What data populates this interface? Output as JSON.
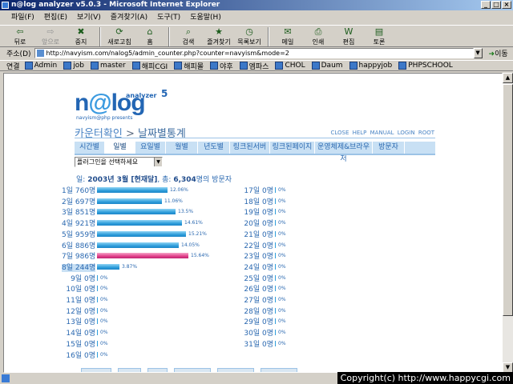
{
  "window": {
    "title": "n@log analyzer v5.0.3 - Microsoft Internet Explorer",
    "min_label": "_",
    "max_label": "□",
    "close_label": "×"
  },
  "menu": [
    "파일(F)",
    "편집(E)",
    "보기(V)",
    "즐겨찾기(A)",
    "도구(T)",
    "도움말(H)"
  ],
  "toolbar": [
    {
      "label": "뒤로",
      "icon": "back-arrow-icon",
      "glyph": "⇦",
      "disabled": false
    },
    {
      "label": "앞으로",
      "icon": "forward-arrow-icon",
      "glyph": "⇨",
      "disabled": true
    },
    {
      "label": "중지",
      "icon": "stop-icon",
      "glyph": "✖",
      "disabled": false
    },
    {
      "label": "새로고침",
      "icon": "refresh-icon",
      "glyph": "⟳",
      "disabled": false
    },
    {
      "label": "홈",
      "icon": "home-icon",
      "glyph": "⌂",
      "disabled": false
    },
    {
      "label": "검색",
      "icon": "search-icon",
      "glyph": "⌕",
      "disabled": false
    },
    {
      "label": "즐겨찾기",
      "icon": "favorites-icon",
      "glyph": "★",
      "disabled": false
    },
    {
      "label": "목록보기",
      "icon": "history-icon",
      "glyph": "◷",
      "disabled": false
    },
    {
      "label": "메일",
      "icon": "mail-icon",
      "glyph": "✉",
      "disabled": false
    },
    {
      "label": "인쇄",
      "icon": "print-icon",
      "glyph": "⎙",
      "disabled": false
    },
    {
      "label": "편집",
      "icon": "edit-icon",
      "glyph": "W",
      "disabled": false
    },
    {
      "label": "토론",
      "icon": "discuss-icon",
      "glyph": "▤",
      "disabled": false
    }
  ],
  "address": {
    "label": "주소(D)",
    "url": "http://navyism.com/nalog5/admin_counter.php?counter=navyism&mode=2",
    "go_label": "이동"
  },
  "links": {
    "label": "연결",
    "items": [
      "Admin",
      "job",
      "master",
      "해피CGI",
      "해피몰",
      "야후",
      "엠파스",
      "CHOL",
      "Daum",
      "happyjob",
      "PHPSCHOOL"
    ]
  },
  "page": {
    "logo_text_a": "n",
    "logo_text_at": "@",
    "logo_text_b": "log",
    "logo_super": "analyzer",
    "logo_version": "5",
    "logo_sub": "navyism@php presents",
    "breadcrumb_parent": "카운터확인",
    "breadcrumb_sep": ">",
    "breadcrumb_current": "날짜별통계",
    "top_links": "CLOSE HELP MANUAL LOGIN ROOT",
    "tabs": [
      "시간별",
      "일별",
      "요일별",
      "월별",
      "년도별",
      "링크된서버",
      "링크된페이지",
      "운영체제&브라우저",
      "방문자"
    ],
    "active_tab": 1,
    "plugin_select": "플러그인을 선택하세요",
    "summary_prefix": "일: ",
    "summary_month": "2003년 3월 [현재달]",
    "summary_total_prefix": ", 총: ",
    "summary_total": "6,304",
    "summary_suffix": "명의 방문자"
  },
  "chart_data": {
    "type": "bar",
    "title": "일: 2003년 3월 [현재달], 총: 6,304명의 방문자",
    "categories": [
      "1일",
      "2일",
      "3일",
      "4일",
      "5일",
      "6일",
      "7일",
      "8일",
      "9일",
      "10일",
      "11일",
      "12일",
      "13일",
      "14일",
      "15일",
      "16일",
      "17일",
      "18일",
      "19일",
      "20일",
      "21일",
      "22일",
      "23일",
      "24일",
      "25일",
      "26일",
      "27일",
      "28일",
      "29일",
      "30일",
      "31일"
    ],
    "values": [
      760,
      697,
      851,
      921,
      959,
      886,
      986,
      244,
      0,
      0,
      0,
      0,
      0,
      0,
      0,
      0,
      0,
      0,
      0,
      0,
      0,
      0,
      0,
      0,
      0,
      0,
      0,
      0,
      0,
      0,
      0
    ],
    "percents": [
      "12.06%",
      "11.06%",
      "13.5%",
      "14.61%",
      "15.21%",
      "14.05%",
      "15.64%",
      "3.87%",
      "0%",
      "0%",
      "0%",
      "0%",
      "0%",
      "0%",
      "0%",
      "0%",
      "0%",
      "0%",
      "0%",
      "0%",
      "0%",
      "0%",
      "0%",
      "0%",
      "0%",
      "0%",
      "0%",
      "0%",
      "0%",
      "0%",
      "0%"
    ],
    "unit": "명",
    "max_index": 6,
    "today_index": 7,
    "colors": {
      "bar": "#2f9edb",
      "max": "#e0408a"
    }
  },
  "status": {
    "copyright": "Copyright(c) http://www.happycgi.com"
  }
}
